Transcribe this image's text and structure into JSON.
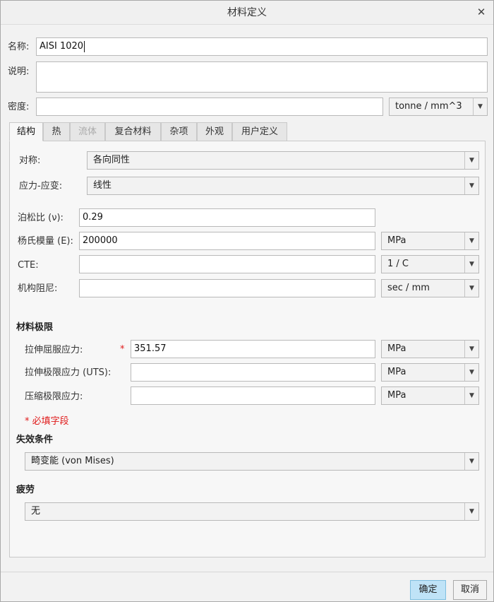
{
  "window": {
    "title": "材料定义"
  },
  "name": {
    "label": "名称:",
    "value": "AISI 1020"
  },
  "description": {
    "label": "说明:",
    "value": ""
  },
  "density": {
    "label": "密度:",
    "value": "",
    "unit": "tonne / mm^3"
  },
  "tabs": [
    {
      "label": "结构",
      "active": true,
      "enabled": true
    },
    {
      "label": "热",
      "active": false,
      "enabled": true
    },
    {
      "label": "流体",
      "active": false,
      "enabled": false
    },
    {
      "label": "复合材料",
      "active": false,
      "enabled": true
    },
    {
      "label": "杂项",
      "active": false,
      "enabled": true
    },
    {
      "label": "外观",
      "active": false,
      "enabled": true
    },
    {
      "label": "用户定义",
      "active": false,
      "enabled": true
    }
  ],
  "structure": {
    "symmetry": {
      "label": "对称:",
      "value": "各向同性"
    },
    "stress_strain": {
      "label": "应力-应变:",
      "value": "线性"
    },
    "poisson": {
      "label": "泊松比 (ν):",
      "value": "0.29"
    },
    "youngs": {
      "label": "杨氏模量 (E):",
      "value": "200000",
      "unit": "MPa"
    },
    "cte": {
      "label": "CTE:",
      "value": "",
      "unit": "1 / C"
    },
    "damping": {
      "label": "机构阻尼:",
      "value": "",
      "unit": "sec / mm"
    }
  },
  "limits": {
    "title": "材料极限",
    "tensile_yield": {
      "label": "拉伸屈服应力:",
      "value": "351.57",
      "unit": "MPa",
      "required_mark": "*"
    },
    "tensile_ultimate": {
      "label": "拉伸极限应力 (UTS):",
      "value": "",
      "unit": "MPa"
    },
    "compressive_ultimate": {
      "label": "压缩极限应力:",
      "value": "",
      "unit": "MPa"
    },
    "required_note": "* 必填字段"
  },
  "failure": {
    "title": "失效条件",
    "value": "畸变能 (von Mises)"
  },
  "fatigue": {
    "title": "疲劳",
    "value": "无"
  },
  "buttons": {
    "ok": "确定",
    "cancel": "取消"
  },
  "colors": {
    "primary_button": "#bfe3f7",
    "required": "#e01b1b"
  }
}
